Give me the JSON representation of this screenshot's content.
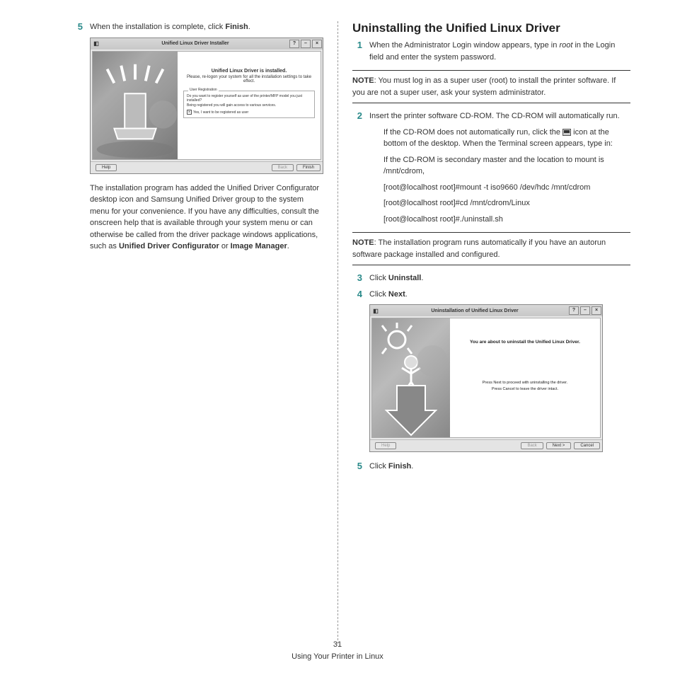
{
  "left": {
    "step5_num": "5",
    "step5_text_a": "When the installation is complete, click ",
    "step5_bold": "Finish",
    "step5_text_b": ".",
    "shot1": {
      "title": "Unified Linux Driver Installer",
      "sysmenu": "?",
      "min": "–",
      "close": "×",
      "heading": "Unified Linux Driver is installed.",
      "sub": "Please, re-logon your system for all the installation settings to take effect.",
      "legend": "User Registration",
      "q1": "Do you want to register yourself as user of the printer/MFP model you just installed?",
      "q2": "Being registered you will gain access to various services.",
      "chk": "Yes, I want to be registered as user",
      "help": "Help",
      "back": "Back",
      "finish": "Finish"
    },
    "para1_a": "The installation program has added the Unified Driver Configurator desktop icon and Samsung Unified Driver group to the system menu for your convenience. If you have any difficulties, consult the onscreen help that is available through your system menu or can otherwise be called from the driver package windows applications, such as ",
    "para1_b1": "Unified Driver Configurator",
    "para1_or": " or ",
    "para1_b2": "Image Manager",
    "para1_dot": "."
  },
  "right": {
    "heading": "Uninstalling the Unified Linux Driver",
    "s1_num": "1",
    "s1_a": "When the Administrator Login window appears, type in ",
    "s1_i": "root",
    "s1_b": " in the Login field and enter the system password.",
    "note1_label": "NOTE",
    "note1_text": ": You must log in as a super user (root) to install the printer software. If you are not a super user, ask your system administrator.",
    "s2_num": "2",
    "s2_text": "Insert the printer software CD-ROM. The CD-ROM will automatically run.",
    "s2_sub1a": "If the CD-ROM does not automatically run, click the ",
    "s2_sub1b": " icon at the bottom of the desktop. When the Terminal screen appears, type in:",
    "s2_sub2": "If the CD-ROM is secondary master and the location to mount is /mnt/cdrom,",
    "s2_cmd1": "[root@localhost root]#mount -t iso9660 /dev/hdc /mnt/cdrom",
    "s2_cmd2": "[root@localhost root]#cd /mnt/cdrom/Linux",
    "s2_cmd3": "[root@localhost root]#./uninstall.sh",
    "note2_label": "NOTE",
    "note2_text": ": The installation program runs automatically if you have an autorun software package installed and configured.",
    "s3_num": "3",
    "s3_a": "Click ",
    "s3_b": "Uninstall",
    "s3_c": ".",
    "s4_num": "4",
    "s4_a": "Click ",
    "s4_b": "Next",
    "s4_c": ".",
    "shot2": {
      "title": "Uninstallation of Unified Linux Driver",
      "h": "You are about to uninstall the Unified Linux Driver.",
      "m1": "Press Next to proceed with uninstalling the driver.",
      "m2": "Press Cancel to leave the driver intact.",
      "help": "Help",
      "back": "Back",
      "next": "Next >",
      "cancel": "Cancel"
    },
    "s5_num": "5",
    "s5_a": "Click ",
    "s5_b": "Finish",
    "s5_c": "."
  },
  "footer": {
    "page": "31",
    "caption": "Using Your Printer in Linux"
  }
}
